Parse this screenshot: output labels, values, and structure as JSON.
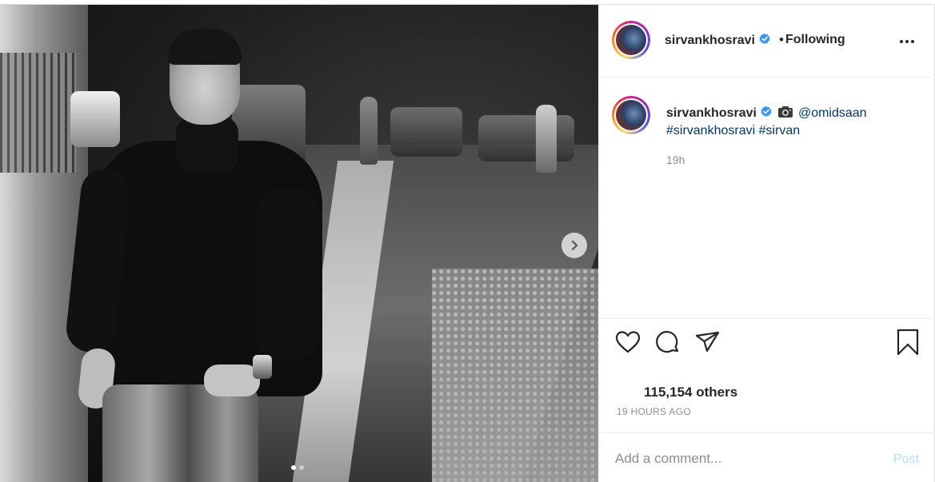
{
  "post": {
    "username": "sirvankhosravi",
    "follow_separator": "•",
    "follow_status": "Following",
    "caption": {
      "mention": "@omidsaan",
      "hashtags": [
        "#sirvankhosravi",
        "#sirvan"
      ],
      "camera_icon": "camera-icon"
    },
    "timestamp": "19h",
    "likes_text": "115,154 others",
    "time_ago": "19 HOURS AGO",
    "carousel": {
      "current": 1,
      "total": 2
    }
  },
  "comment": {
    "placeholder": "Add a comment...",
    "post_label": "Post"
  },
  "colors": {
    "verified": "#3897f0",
    "link": "#00376b",
    "muted": "#8e8e8e",
    "post_button_disabled": "#b2dffc"
  },
  "icons": [
    "verified-badge-icon",
    "more-options-icon",
    "heart-icon",
    "comment-icon",
    "share-icon",
    "bookmark-icon",
    "chevron-right-icon",
    "camera-icon"
  ]
}
